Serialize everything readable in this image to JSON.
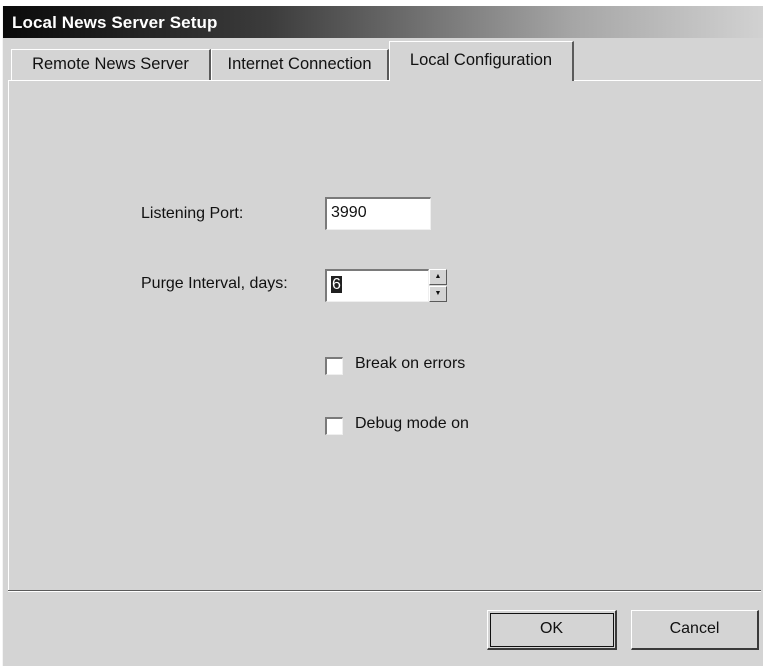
{
  "window": {
    "title": "Local News Server Setup"
  },
  "tabs": [
    {
      "label": "Remote News Server",
      "active": false
    },
    {
      "label": "Internet Connection",
      "active": false
    },
    {
      "label": "Local Configuration",
      "active": true
    }
  ],
  "form": {
    "listening_port": {
      "label": "Listening Port:",
      "value": "3990"
    },
    "purge_interval": {
      "label": "Purge Interval, days:",
      "value": "6"
    },
    "break_on_errors": {
      "label": "Break on errors",
      "checked": false
    },
    "debug_mode": {
      "label": "Debug mode on",
      "checked": false
    }
  },
  "buttons": {
    "ok": "OK",
    "cancel": "Cancel"
  },
  "icons": {
    "spin_up": "up-arrow-icon",
    "spin_down": "down-arrow-icon"
  }
}
